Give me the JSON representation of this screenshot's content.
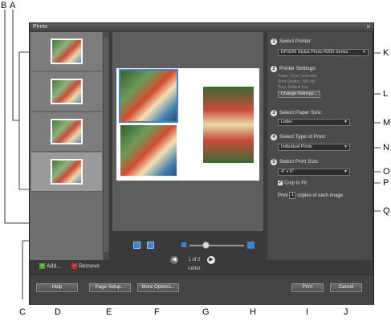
{
  "window": {
    "title": "Prints",
    "close_glyph": "×"
  },
  "callouts": [
    "A",
    "B",
    "C",
    "D",
    "E",
    "F",
    "G",
    "H",
    "I",
    "J",
    "K",
    "L",
    "M",
    "N",
    "O",
    "P",
    "Q"
  ],
  "thumbs": {
    "add_label": "Add...",
    "remove_label": "Remove"
  },
  "preview": {
    "page_count": "1 of 2",
    "paper_name": "Letter"
  },
  "settings": {
    "step1": {
      "num": "1",
      "label": "Select Printer:",
      "value": "EPSON Stylus Photo R200 Series"
    },
    "step2": {
      "num": "2",
      "label": "Printer Settings:",
      "paper_type": "Paper Type: Unknown",
      "print_quality": "Print Quality: 300 dpi",
      "tray": "Tray: Default tray",
      "button": "Change Settings..."
    },
    "step3": {
      "num": "3",
      "label": "Select Paper Size:",
      "value": "Letter"
    },
    "step4": {
      "num": "4",
      "label": "Select Type of Print:",
      "value": "Individual Prints"
    },
    "step5": {
      "num": "5",
      "label": "Select Print Size:",
      "value": "4\" x 6\"",
      "crop_label": "Crop to Fit",
      "print_label": "Print",
      "copies_value": "1",
      "copies_label": "copies of each image"
    }
  },
  "bottom": {
    "help": "Help",
    "page_setup": "Page Setup...",
    "more_options": "More Options...",
    "print": "Print",
    "cancel": "Cancel"
  }
}
